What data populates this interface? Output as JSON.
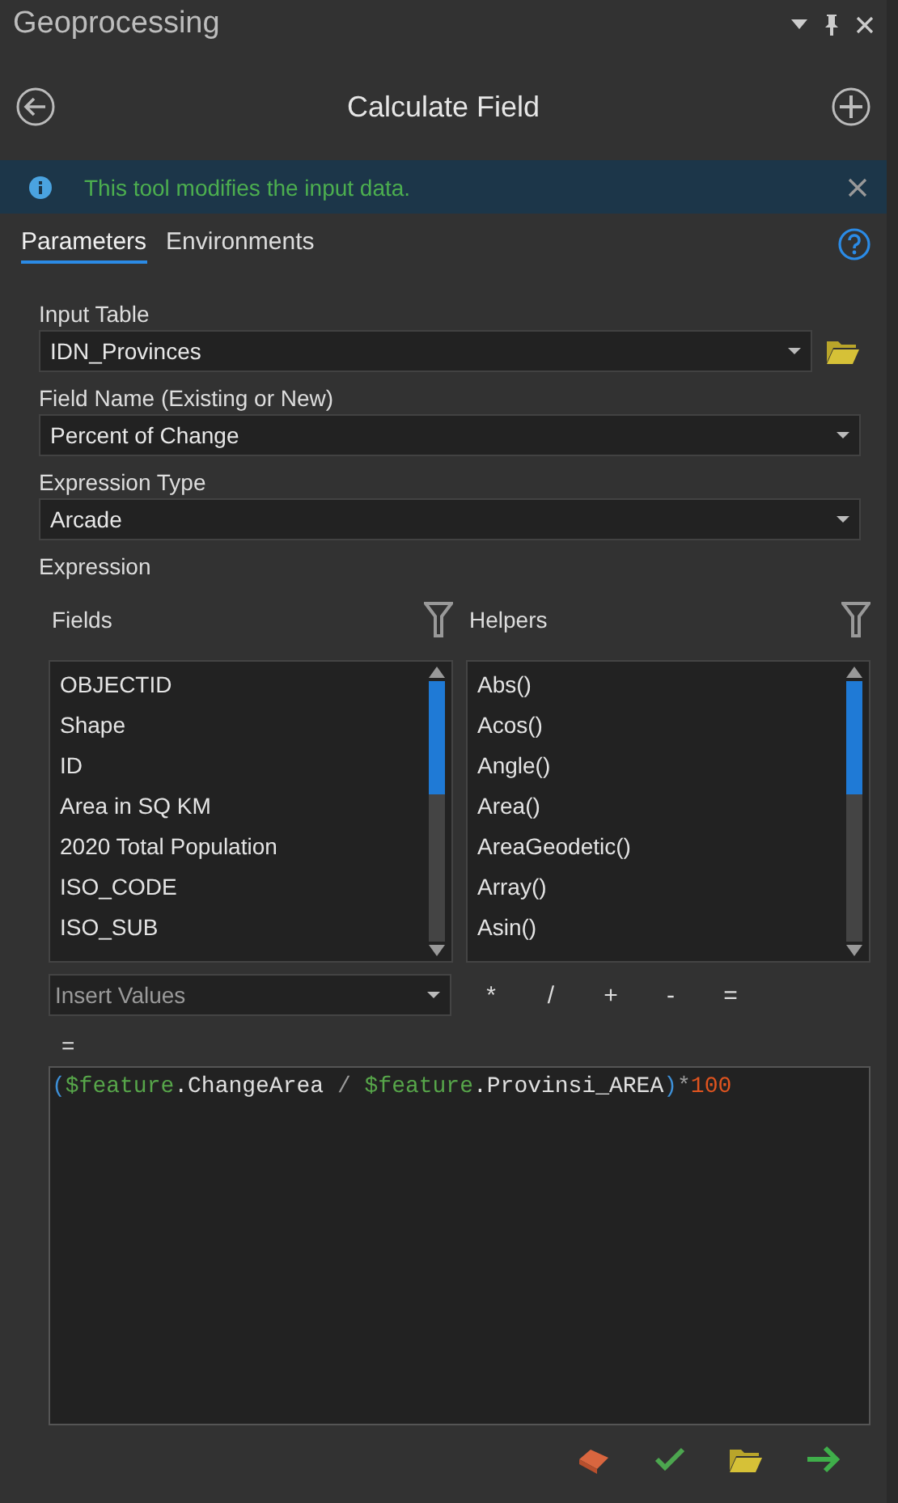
{
  "window": {
    "title": "Geoprocessing"
  },
  "tool": {
    "title": "Calculate Field"
  },
  "info_bar": {
    "text": "This tool modifies the input data."
  },
  "tabs": [
    {
      "label": "Parameters",
      "selected": true
    },
    {
      "label": "Environments",
      "selected": false
    }
  ],
  "parameters": [
    {
      "label": "Input Table",
      "value": "IDN_Provinces",
      "browse": true
    },
    {
      "label": "Field Name (Existing or New)",
      "value": "Percent of Change",
      "browse": false
    },
    {
      "label": "Expression Type",
      "value": "Arcade",
      "browse": false
    }
  ],
  "expression": {
    "label": "Expression",
    "fields": {
      "title": "Fields",
      "items": [
        "OBJECTID",
        "Shape",
        "ID",
        "Area in SQ KM",
        "2020 Total Population",
        "ISO_CODE",
        "ISO_SUB"
      ]
    },
    "helpers": {
      "title": "Helpers",
      "items": [
        "Abs()",
        "Acos()",
        "Angle()",
        "Area()",
        "AreaGeodetic()",
        "Array()",
        "Asin()"
      ]
    },
    "insert_values": {
      "placeholder": "Insert Values"
    },
    "operators": [
      "*",
      "/",
      "+",
      "-",
      "="
    ],
    "prefix": "=",
    "code": [
      {
        "kind": "paren",
        "text": "("
      },
      {
        "kind": "keyword",
        "text": "$feature"
      },
      {
        "kind": "plain",
        "text": ".ChangeArea"
      },
      {
        "kind": "operator",
        "text": " / "
      },
      {
        "kind": "keyword",
        "text": "$feature"
      },
      {
        "kind": "plain",
        "text": ".Provinsi_AREA"
      },
      {
        "kind": "paren",
        "text": ")"
      },
      {
        "kind": "operator",
        "text": "*"
      },
      {
        "kind": "number",
        "text": "100"
      }
    ]
  }
}
